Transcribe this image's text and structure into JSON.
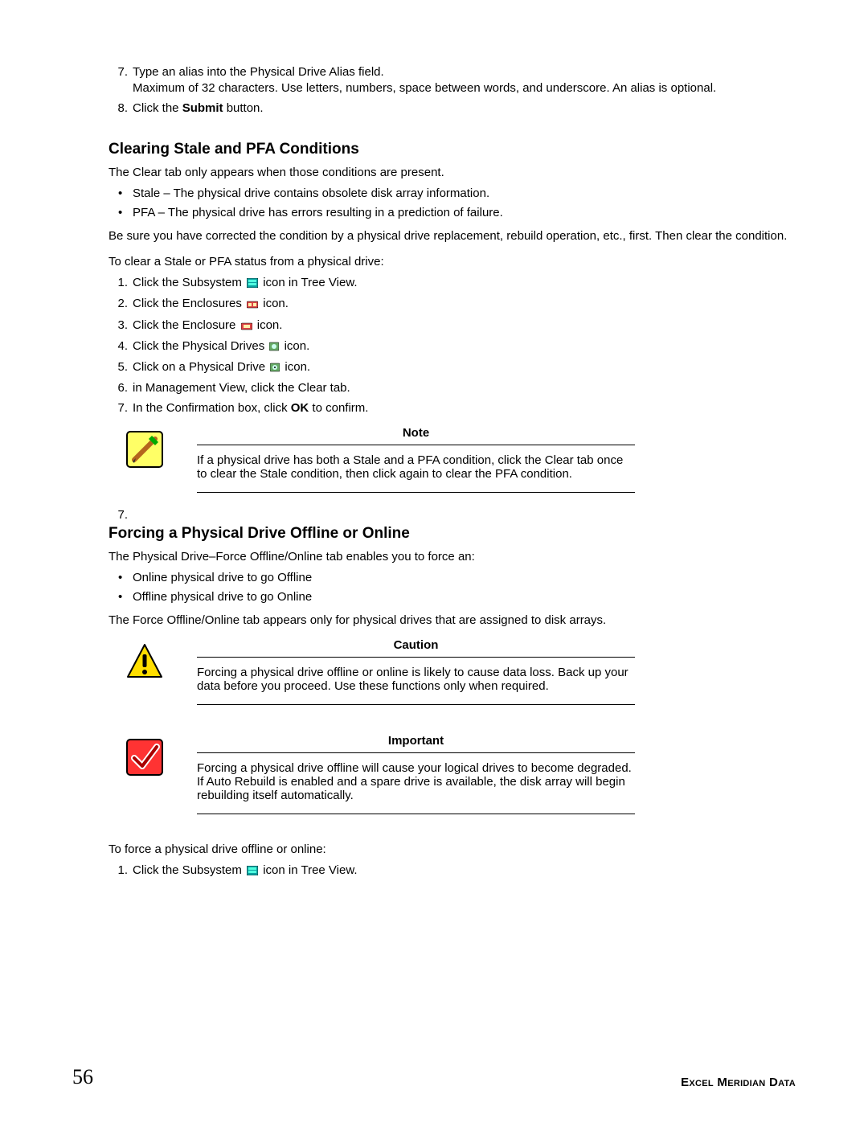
{
  "top": {
    "step7_num": "7.",
    "step7a": "Type an alias into the Physical Drive Alias field.",
    "step7b": "Maximum of 32 characters. Use letters, numbers, space between words, and underscore. An alias is optional.",
    "step8_num": "8.",
    "step8_pre": "Click the ",
    "step8_bold": "Submit",
    "step8_post": " button."
  },
  "clearing": {
    "heading": "Clearing Stale and PFA Conditions",
    "intro": "The Clear tab only appears when those conditions are present.",
    "bullet1": "Stale – The physical drive contains obsolete disk array information.",
    "bullet2": "PFA – The physical drive has errors resulting in a prediction of failure.",
    "para1": "Be sure you have corrected the condition by a physical drive replacement, rebuild operation, etc., first. Then clear the condition.",
    "para2": "To clear a Stale or PFA status from a physical drive:",
    "step1_num": "1.",
    "step1_pre": "Click the Subsystem ",
    "step1_post": " icon in Tree View.",
    "step2_num": "2.",
    "step2_pre": "Click the Enclosures ",
    "step2_post": " icon.",
    "step3_num": "3.",
    "step3_pre": "Click the Enclosure ",
    "step3_post": " icon.",
    "step4_num": "4.",
    "step4_pre": "Click the Physical Drives ",
    "step4_post": " icon.",
    "step5_num": "5.",
    "step5_pre": "Click on a Physical Drive ",
    "step5_post": " icon.",
    "step6_num": "6.",
    "step6": "in Management View, click the Clear tab.",
    "step7_num": "7.",
    "step7_pre": "In the Confirmation box, click ",
    "step7_bold": "OK",
    "step7_post": " to confirm.",
    "trailing_num": "7.",
    "note": {
      "title": "Note",
      "body": "If a physical drive has both a Stale and a PFA condition, click the Clear tab once to clear the Stale condition, then click again to clear the PFA condition."
    }
  },
  "forcing": {
    "heading": "Forcing a Physical Drive Offline or Online",
    "intro": "The Physical Drive–Force Offline/Online tab enables you to force an:",
    "bullet1": "Online physical drive to go Offline",
    "bullet2": "Offline physical drive to go Online",
    "para1": "The Force Offline/Online tab appears only for physical drives that are assigned to disk arrays.",
    "caution": {
      "title": "Caution",
      "body": "Forcing a physical drive offline or online is likely to cause data loss. Back up your data before you proceed. Use these functions only when required."
    },
    "important": {
      "title": "Important",
      "body": "Forcing a physical drive offline will cause your logical drives to become degraded. If Auto Rebuild is enabled and a spare drive is available, the disk array will begin rebuilding itself automatically."
    },
    "para2": "To force a physical drive offline or online:",
    "step1_num": "1.",
    "step1_pre": "Click the Subsystem ",
    "step1_post": " icon in Tree View."
  },
  "footer": {
    "page": "56",
    "brand": "Excel Meridian Data"
  }
}
